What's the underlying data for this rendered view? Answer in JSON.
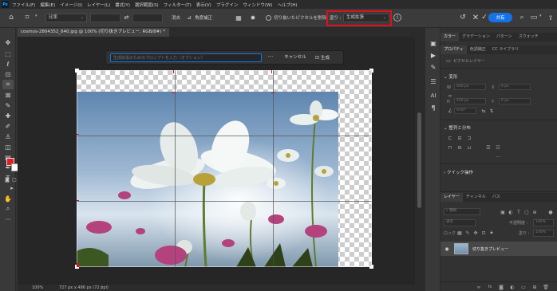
{
  "menubar": {
    "logo": "Ps",
    "items": [
      "ファイル(F)",
      "編集(E)",
      "イメージ(I)",
      "レイヤー(L)",
      "書式(Y)",
      "選択範囲(S)",
      "フィルター(T)",
      "表示(V)",
      "プラグイン",
      "ウィンドウ(W)",
      "ヘルプ(H)"
    ]
  },
  "optionsbar": {
    "ratio_label": "比率",
    "clear_label": "消去",
    "straighten_label": "角度補正",
    "delete_cropped_label": "切り抜いたピクセルを削除",
    "fill_label": "塗り :",
    "fill_value": "生成拡張",
    "share_label": "共有"
  },
  "document": {
    "tab_title": "cosmos-2804352_640.jpg @ 100% (切り抜きプレビュー, RGB/8#) *",
    "prompt_placeholder": "生成拡張のためのプロンプトを入力（オプション）",
    "more_label": "···",
    "cancel_label": "キャンセル",
    "generate_label": "生成",
    "status_zoom": "100%",
    "status_info": "727 px x 486 px (72 ppi)"
  },
  "panels": {
    "top_tabs": [
      "カラー",
      "グラデーション",
      "パターン",
      "スウォッチ"
    ],
    "props_tabs": [
      "プロパティ",
      "色調補正",
      "CC ライブラリ"
    ],
    "props_subtitle": "ピクセルレイヤー",
    "transform_title": "変形",
    "w_label": "W",
    "w_value": "640 px",
    "x_label": "X",
    "x_value": "0 px",
    "h_label": "H",
    "h_value": "426 px",
    "y_label": "Y",
    "y_value": "0 px",
    "angle_value": "0.00°",
    "align_title": "整列と分布",
    "quick_title": "クイック操作",
    "layers_tabs": [
      "レイヤー",
      "チャンネル",
      "パス"
    ],
    "search_placeholder": "種類",
    "blend_mode": "通常",
    "opacity_label": "不透明度 :",
    "opacity_value": "100%",
    "lock_label": "ロック :",
    "fill_label": "塗り :",
    "fill_value": "100%",
    "layer_name": "切り抜きプレビュー"
  },
  "colors": {
    "accent": "#1473e6",
    "highlight": "#e0101a",
    "foreground": "#e51c23",
    "background": "#ffffff"
  }
}
